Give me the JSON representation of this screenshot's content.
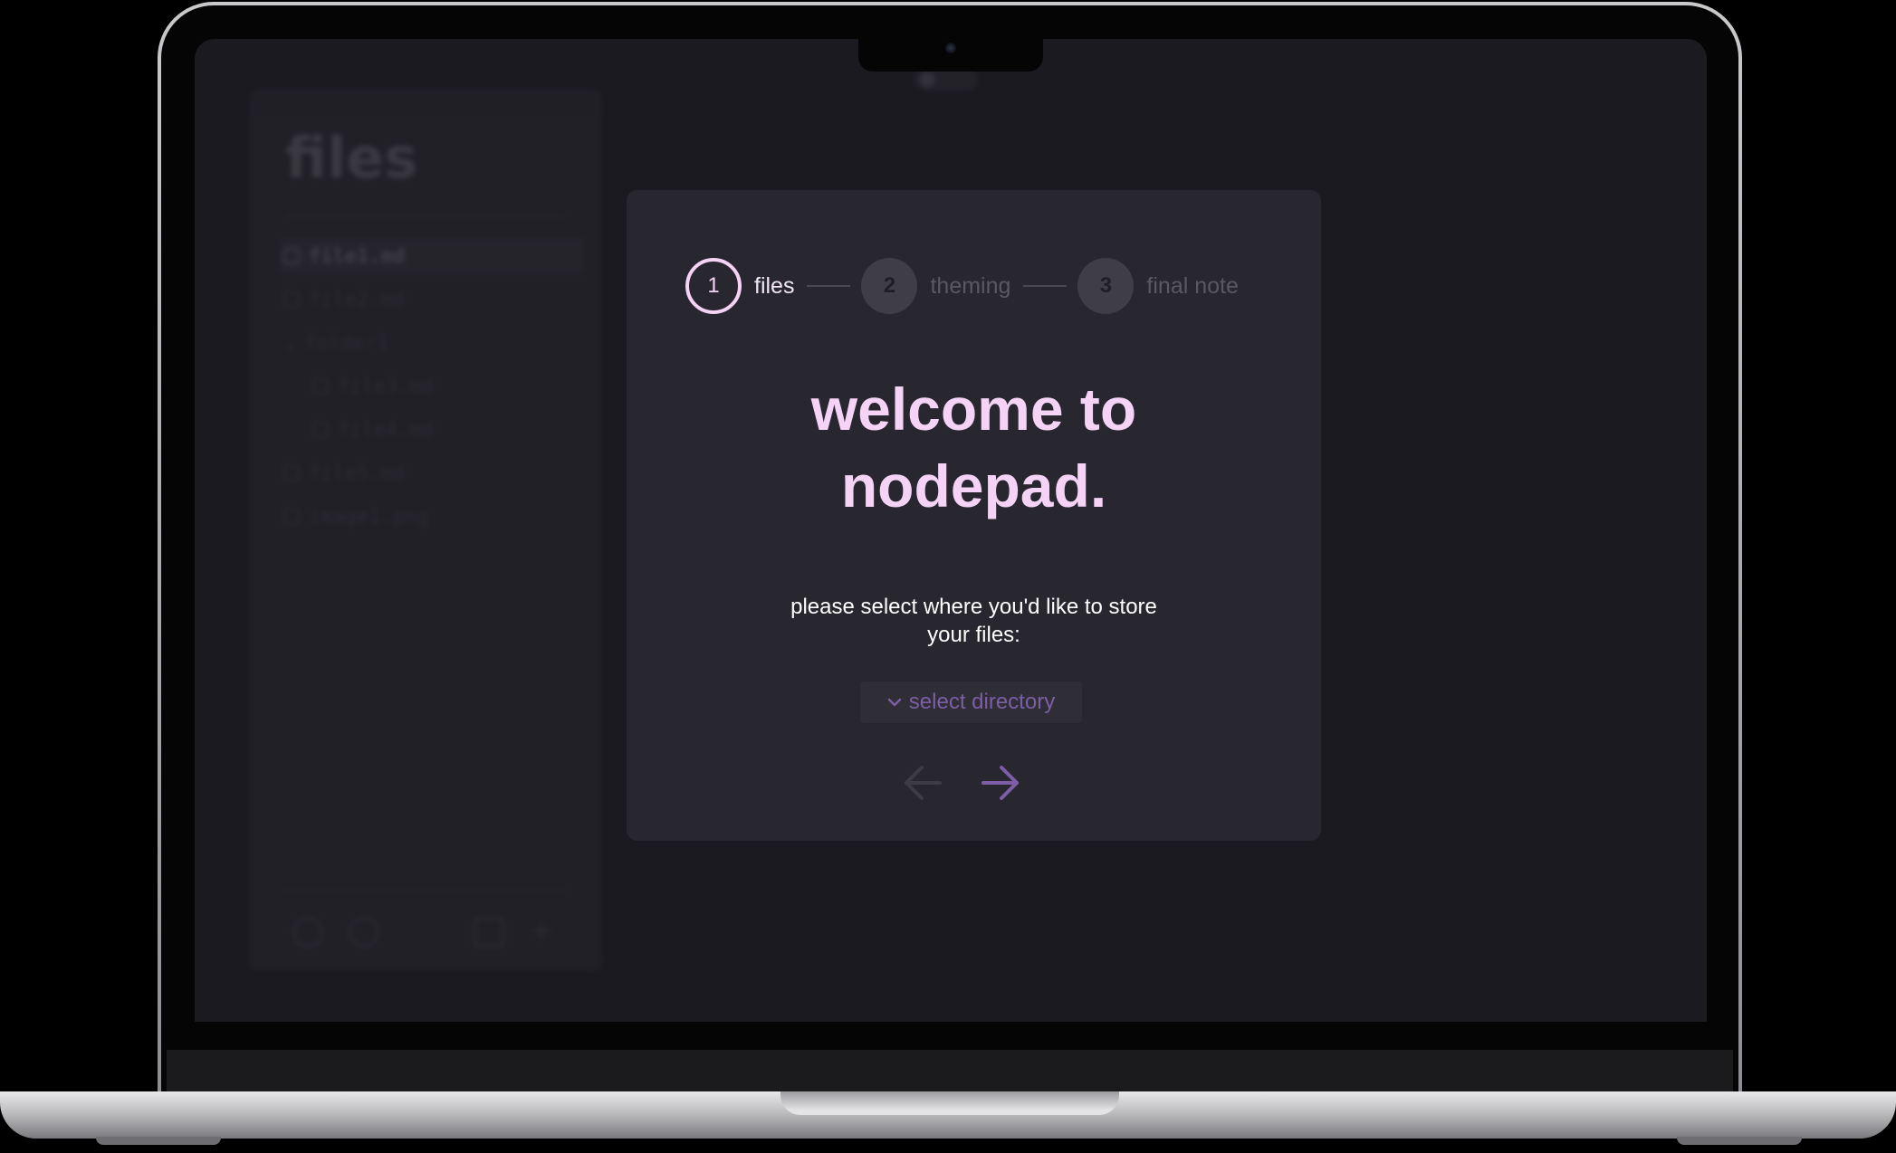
{
  "background_app": {
    "sidebar_title": "files",
    "files": [
      {
        "name": "file1.md",
        "active": true,
        "indent": false
      },
      {
        "name": "file2.md",
        "active": false,
        "indent": false
      },
      {
        "name": "folder1",
        "active": false,
        "indent": false
      },
      {
        "name": "file3.md",
        "active": false,
        "indent": true
      },
      {
        "name": "file4.md",
        "active": false,
        "indent": true
      },
      {
        "name": "file5.md",
        "active": false,
        "indent": false
      },
      {
        "name": "image1.png",
        "active": false,
        "indent": false
      }
    ]
  },
  "onboarding": {
    "steps": [
      {
        "number": "1",
        "label": "files",
        "active": true
      },
      {
        "number": "2",
        "label": "theming",
        "active": false
      },
      {
        "number": "3",
        "label": "final note",
        "active": false
      }
    ],
    "title_line1": "welcome to",
    "title_line2": "nodepad.",
    "prompt": "please select where you'd like to store your files:",
    "select_button_label": "select directory",
    "back_icon": "arrow-left-icon",
    "next_icon": "arrow-right-icon"
  },
  "colors": {
    "accent": "#f5d3f7",
    "button_text": "#7d5ea6",
    "modal_bg": "#28262e",
    "screen_bg": "#1b1a20"
  }
}
